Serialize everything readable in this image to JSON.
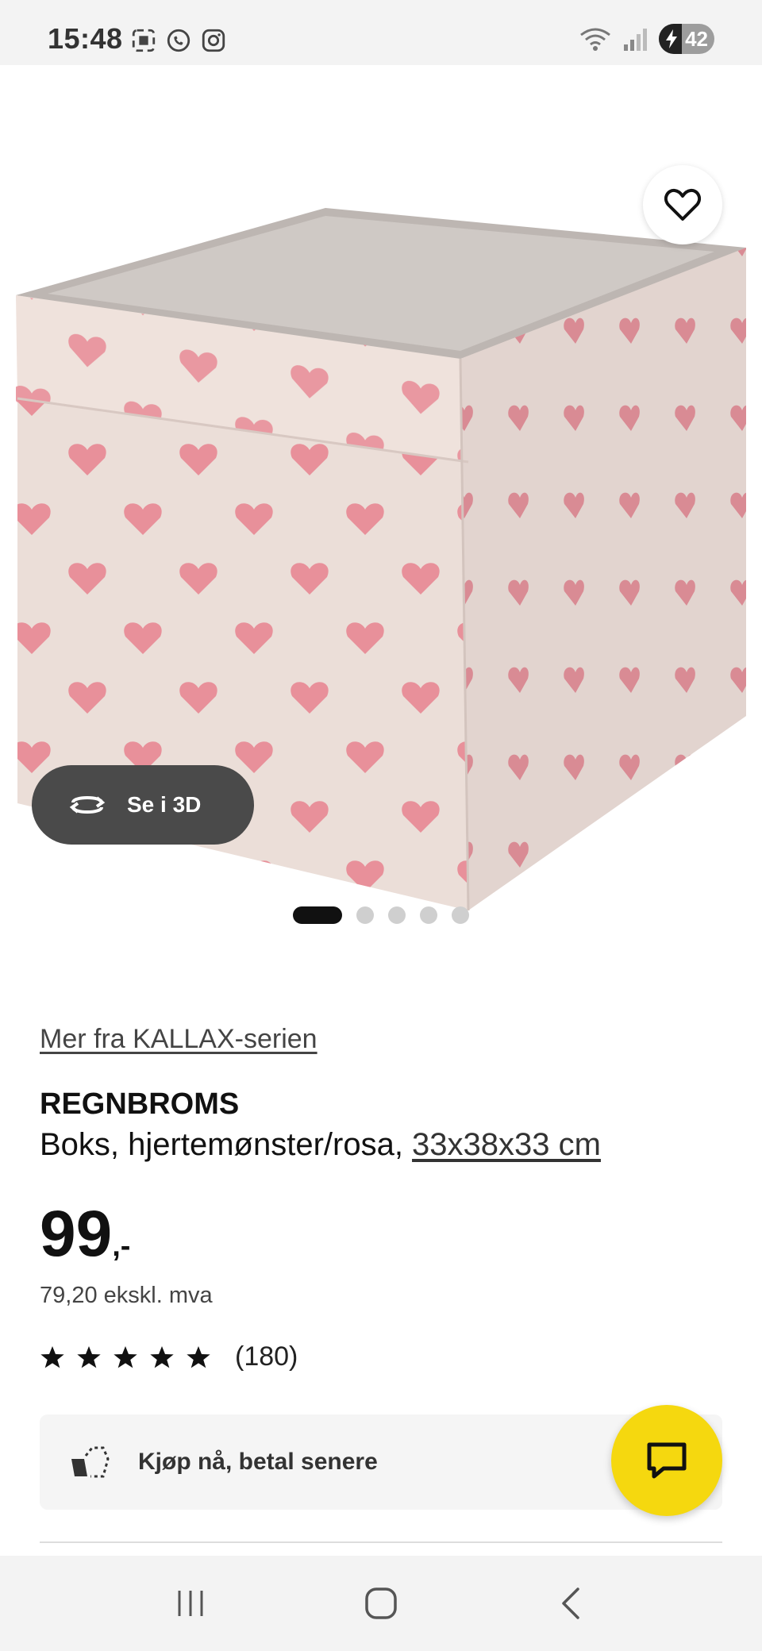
{
  "status_bar": {
    "time": "15:48",
    "battery_level": "42"
  },
  "product_image": {
    "view_3d_label": "Se i 3D",
    "carousel_pages": 5,
    "carousel_active_index": 0
  },
  "product": {
    "series_link": "Mer fra KALLAX-serien",
    "name": "REGNBROMS",
    "description": "Boks, hjertemønster/rosa, ",
    "size_link": "33x38x33 cm",
    "price_main": "99",
    "price_suffix": ",-",
    "price_ex_vat": "79,20 ekskl. mva",
    "rating_stars": 5,
    "rating_count": "(180)"
  },
  "bnpl": {
    "label": "Kjøp nå, betal senere"
  },
  "colors": {
    "accent_yellow": "#f5d80f",
    "dark": "#111111",
    "heart_pink": "#e8909a",
    "box_fabric": "#efe2dc"
  },
  "icons": {
    "favorite": "heart-outline-icon",
    "view_3d": "rotate-3d-icon",
    "chat": "chat-bubble-icon",
    "bnpl": "pay-later-icon"
  }
}
